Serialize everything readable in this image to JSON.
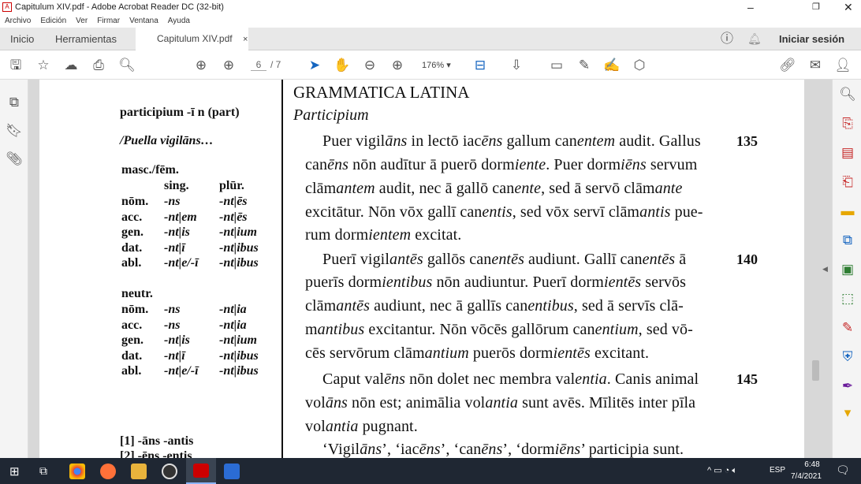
{
  "window": {
    "title": "Capitulum XIV.pdf - Adobe Acrobat Reader DC (32-bit)"
  },
  "menu": [
    "Archivo",
    "Edición",
    "Ver",
    "Firmar",
    "Ventana",
    "Ayuda"
  ],
  "tabs": {
    "home": "Inicio",
    "tools": "Herramientas",
    "doc": "Capitulum XIV.pdf",
    "close": "×",
    "signin": "Iniciar sesión"
  },
  "toolbar": {
    "page_current": "6",
    "page_total": "/ 7",
    "zoom": "176%"
  },
  "left_column": {
    "heading": "participium -ī n (part)",
    "example": "/Puella vigilāns…",
    "mascfem": "masc./fēm.",
    "sing": "sing.",
    "plur": "plūr.",
    "rows1": [
      [
        "nōm.",
        "-ns",
        "-nt|ēs"
      ],
      [
        "acc.",
        "-nt|em",
        "-nt|ēs"
      ],
      [
        "gen.",
        "-nt|is",
        "-nt|ium"
      ],
      [
        "dat.",
        "-nt|ī",
        "-nt|ibus"
      ],
      [
        "abl.",
        "-nt|e/-ī",
        "-nt|ibus"
      ]
    ],
    "neutr": "neutr.",
    "rows2": [
      [
        "nōm.",
        "-ns",
        "-nt|ia"
      ],
      [
        "acc.",
        "-ns",
        "-nt|ia"
      ],
      [
        "gen.",
        "-nt|is",
        "-nt|ium"
      ],
      [
        "dat.",
        "-nt|ī",
        "-nt|ibus"
      ],
      [
        "abl.",
        "-nt|e/-ī",
        "-nt|ibus"
      ]
    ],
    "foot1": "[1] -āns -antis",
    "foot2": "[2] -ēns -entis"
  },
  "main": {
    "title": "GRAMMATICA LATINA",
    "subtitle": "Participium",
    "lines": [
      {
        "t": "   Puer vigil*āns* in lectō iac*ēns* gallum can*entem* audit. Gallus",
        "n": "135"
      },
      {
        "t": "can*ēns* nōn audītur ā puerō dorm*iente*. Puer dorm*iēns* servum"
      },
      {
        "t": "clām*antem* audit, nec ā gallō can*ente*, sed ā servō clām*ante*"
      },
      {
        "t": "excitātur. Nōn vōx gallī can*entis*, sed vōx servī clām*antis* pue-"
      },
      {
        "t": "rum dorm*ientem* excitat."
      },
      {
        "t": "   Puerī vigil*antēs* gallōs can*entēs* audiunt. Gallī can*entēs* ā",
        "n": "140"
      },
      {
        "t": "puerīs dorm*ientibus* nōn audiuntur. Puerī dorm*ientēs* servōs"
      },
      {
        "t": "clām*antēs* audiunt, nec ā gallīs can*entibus*, sed ā servīs clā-"
      },
      {
        "t": "m*antibus* excitantur. Nōn vōcēs gallōrum can*entium*, sed vō-"
      },
      {
        "t": "cēs servōrum clām*antium* puerōs dorm*ientēs* excitant."
      },
      {
        "t": "   Caput val*ēns* nōn dolet nec membra val*entia*. Canis animal",
        "n": "145"
      },
      {
        "t": "vol*āns* nōn est; animālia vol*antia* sunt avēs. Mīlitēs inter pīla"
      },
      {
        "t": "vol*antia* pugnant."
      },
      {
        "t": "   ‘Vigil*āns*’, ‘iac*ēns*’, ‘can*ēns*’, ‘dorm*iēns*’ participia sunt."
      }
    ]
  },
  "taskbar": {
    "lang": "ESP",
    "time": "6:48",
    "date": "7/4/2021"
  }
}
